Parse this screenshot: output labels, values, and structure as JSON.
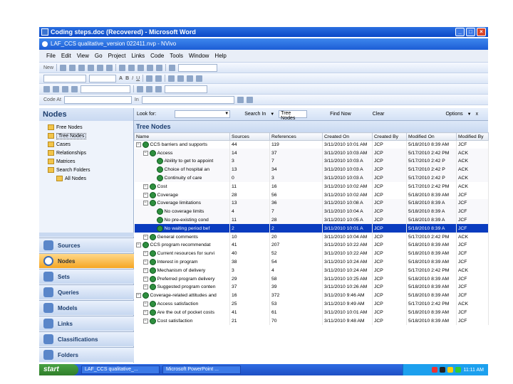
{
  "outer_window": {
    "title": "Coding steps.doc (Recovered) - Microsoft Word"
  },
  "nvivo_window": {
    "title": "LAF_CCS qualitative_version 022411.nvp - NVivo"
  },
  "menu": [
    "File",
    "Edit",
    "View",
    "Go",
    "Project",
    "Links",
    "Code",
    "Tools",
    "Window",
    "Help"
  ],
  "toolbar": {
    "new_label": "New",
    "code_at_label": "Code At",
    "in_label": "In"
  },
  "nodes_pane": {
    "title": "Nodes",
    "tree": [
      {
        "label": "Free Nodes",
        "selected": false,
        "indent": 0
      },
      {
        "label": "Tree Nodes",
        "selected": true,
        "indent": 0
      },
      {
        "label": "Cases",
        "selected": false,
        "indent": 0
      },
      {
        "label": "Relationships",
        "selected": false,
        "indent": 0
      },
      {
        "label": "Matrices",
        "selected": false,
        "indent": 0
      },
      {
        "label": "Search Folders",
        "selected": false,
        "indent": 0
      },
      {
        "label": "All Nodes",
        "selected": false,
        "indent": 1
      }
    ],
    "nav_buttons": [
      "Sources",
      "Nodes",
      "Sets",
      "Queries",
      "Models",
      "Links",
      "Classifications",
      "Folders"
    ],
    "active_nav": "Nodes"
  },
  "find_bar": {
    "look_for_label": "Look for:",
    "search_in_label": "Search In",
    "search_in_value": "Tree Nodes",
    "find_now_label": "Find Now",
    "clear_label": "Clear",
    "options_label": "Options",
    "close_glyph": "x"
  },
  "tree_nodes": {
    "title": "Tree Nodes",
    "columns": [
      "Name",
      "Sources",
      "References",
      "Created On",
      "Created By",
      "Modified On",
      "Modified By"
    ],
    "rows": [
      {
        "name": "CCS barriers and supports",
        "sources": "44",
        "refs": "119",
        "created_on": "3/11/2010 10:01 AM",
        "created_by": "JCP",
        "modified_on": "5/18/2010 8:39 AM",
        "modified_by": "JCF",
        "level": 0,
        "style": "normal"
      },
      {
        "name": "Access",
        "sources": "14",
        "refs": "37",
        "created_on": "3/11/2010 10:03 AM",
        "created_by": "JCP",
        "modified_on": "5/17/2010 2:42 PM",
        "modified_by": "ACK",
        "level": 1,
        "style": "sub"
      },
      {
        "name": "Ability to get to appoint",
        "sources": "3",
        "refs": "7",
        "created_on": "3/11/2010 10:03 A",
        "created_by": "JCP",
        "modified_on": "5/17/2010 2:42 P",
        "modified_by": "ACK",
        "level": 2,
        "style": "sub"
      },
      {
        "name": "Choice of hospital an",
        "sources": "13",
        "refs": "34",
        "created_on": "3/11/2010 10:03 A",
        "created_by": "JCP",
        "modified_on": "5/17/2010 2:42 P",
        "modified_by": "ACK",
        "level": 2,
        "style": "sub"
      },
      {
        "name": "Continuity of care",
        "sources": "0",
        "refs": "3",
        "created_on": "3/11/2010 10:03 A",
        "created_by": "JCP",
        "modified_on": "5/17/2010 2:42 P",
        "modified_by": "ACK",
        "level": 2,
        "style": "sub"
      },
      {
        "name": "Cost",
        "sources": "11",
        "refs": "16",
        "created_on": "3/11/2010 10:02 AM",
        "created_by": "JCP",
        "modified_on": "5/17/2010 2:42 PM",
        "modified_by": "ACK",
        "level": 1,
        "style": "normal"
      },
      {
        "name": "Coverage",
        "sources": "28",
        "refs": "56",
        "created_on": "3/11/2010 10:02 AM",
        "created_by": "JCP",
        "modified_on": "5/18/2010 8:39 AM",
        "modified_by": "JCF",
        "level": 1,
        "style": "normal"
      },
      {
        "name": "Coverage limitations",
        "sources": "13",
        "refs": "36",
        "created_on": "3/11/2010 10:08 A",
        "created_by": "JCP",
        "modified_on": "5/18/2010 8:39 A",
        "modified_by": "JCF",
        "level": 1,
        "style": "sub"
      },
      {
        "name": "No coverage limits",
        "sources": "4",
        "refs": "7",
        "created_on": "3/11/2010 10:04 A",
        "created_by": "JCP",
        "modified_on": "5/18/2010 8:39 A",
        "modified_by": "JCF",
        "level": 2,
        "style": "sub"
      },
      {
        "name": "No pre-existing cond",
        "sources": "11",
        "refs": "28",
        "created_on": "3/11/2010 10:05 A",
        "created_by": "JCP",
        "modified_on": "5/18/2010 8:39 A",
        "modified_by": "JCF",
        "level": 2,
        "style": "sub"
      },
      {
        "name": "No waiting period bef",
        "sources": "2",
        "refs": "2",
        "created_on": "3/11/2010 10:01 A",
        "created_by": "JCP",
        "modified_on": "5/18/2010 8:39 A",
        "modified_by": "JCF",
        "level": 2,
        "style": "selected"
      },
      {
        "name": "General comments",
        "sources": "10",
        "refs": "20",
        "created_on": "3/11/2010 10:04 AM",
        "created_by": "JCP",
        "modified_on": "5/17/2010 2:42 PM",
        "modified_by": "ACK",
        "level": 1,
        "style": "normal"
      },
      {
        "name": "CCS program recommendat",
        "sources": "41",
        "refs": "207",
        "created_on": "3/11/2010 10:22 AM",
        "created_by": "JCP",
        "modified_on": "5/18/2010 8:39 AM",
        "modified_by": "JCF",
        "level": 0,
        "style": "normal"
      },
      {
        "name": "Current resources for survi",
        "sources": "40",
        "refs": "52",
        "created_on": "3/11/2010 10:22 AM",
        "created_by": "JCP",
        "modified_on": "5/18/2010 8:39 AM",
        "modified_by": "JCF",
        "level": 1,
        "style": "normal"
      },
      {
        "name": "Interest in program",
        "sources": "38",
        "refs": "54",
        "created_on": "3/11/2010 10:24 AM",
        "created_by": "JCP",
        "modified_on": "5/18/2010 8:39 AM",
        "modified_by": "JCF",
        "level": 1,
        "style": "normal"
      },
      {
        "name": "Mechanism of delivery",
        "sources": "3",
        "refs": "4",
        "created_on": "3/11/2010 10:24 AM",
        "created_by": "JCP",
        "modified_on": "5/17/2010 2:42 PM",
        "modified_by": "ACK",
        "level": 1,
        "style": "normal"
      },
      {
        "name": "Preferred program delivery",
        "sources": "29",
        "refs": "58",
        "created_on": "3/11/2010 10:25 AM",
        "created_by": "JCP",
        "modified_on": "5/18/2010 8:39 AM",
        "modified_by": "JCF",
        "level": 1,
        "style": "normal"
      },
      {
        "name": "Suggested program conten",
        "sources": "37",
        "refs": "39",
        "created_on": "3/11/2010 10:26 AM",
        "created_by": "JCP",
        "modified_on": "5/18/2010 8:39 AM",
        "modified_by": "JCF",
        "level": 1,
        "style": "normal"
      },
      {
        "name": "Coverage-related attitudes and",
        "sources": "16",
        "refs": "372",
        "created_on": "3/11/2010 9:46 AM",
        "created_by": "JCP",
        "modified_on": "5/18/2010 8:39 AM",
        "modified_by": "JCF",
        "level": 0,
        "style": "normal"
      },
      {
        "name": "Access satisfaction",
        "sources": "25",
        "refs": "53",
        "created_on": "3/11/2010 9:49 AM",
        "created_by": "JCP",
        "modified_on": "5/17/2010 2:42 PM",
        "modified_by": "ACK",
        "level": 1,
        "style": "normal"
      },
      {
        "name": "Are the out of pocket costs",
        "sources": "41",
        "refs": "61",
        "created_on": "3/11/2010 10:01 AM",
        "created_by": "JCP",
        "modified_on": "5/18/2010 8:39 AM",
        "modified_by": "JCF",
        "level": 1,
        "style": "normal"
      },
      {
        "name": "Cost satisfaction",
        "sources": "21",
        "refs": "70",
        "created_on": "3/11/2010 9:48 AM",
        "created_by": "JCP",
        "modified_on": "5/18/2010 8:39 AM",
        "modified_by": "JCF",
        "level": 1,
        "style": "normal"
      }
    ]
  },
  "taskbar": {
    "start_label": "start",
    "tasks": [
      "LAF_CCS qualitative_...",
      "Microsoft PowerPoint ..."
    ],
    "clock": "11:11 AM"
  }
}
